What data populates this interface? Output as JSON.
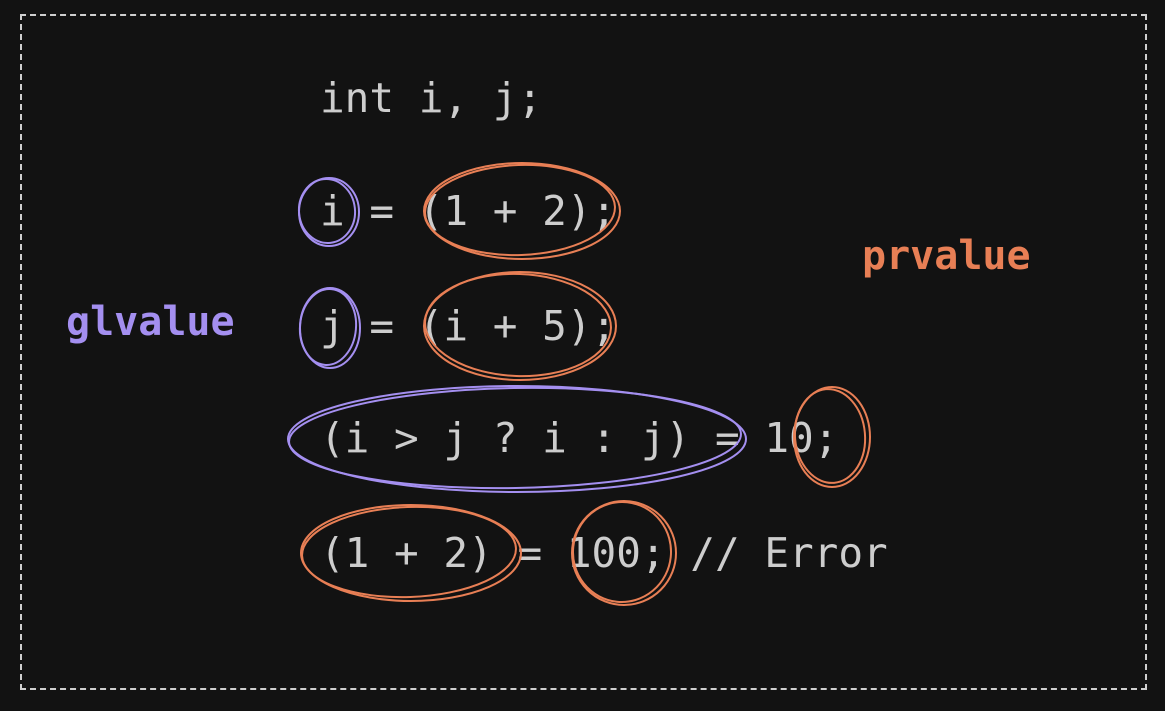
{
  "code_lines": [
    "int i, j;",
    "i = (1 + 2);",
    "j = (i + 5);",
    "(i > j ? i : j) = 10;",
    "(1 + 2) = 100; // Error"
  ],
  "labels": {
    "glvalue": "glvalue",
    "prvalue": "prvalue"
  },
  "colors": {
    "background": "#121212",
    "code_text": "#cdcdcd",
    "glvalue": "#a48ff0",
    "prvalue": "#e87f55",
    "frame": "#cfcfcf"
  }
}
